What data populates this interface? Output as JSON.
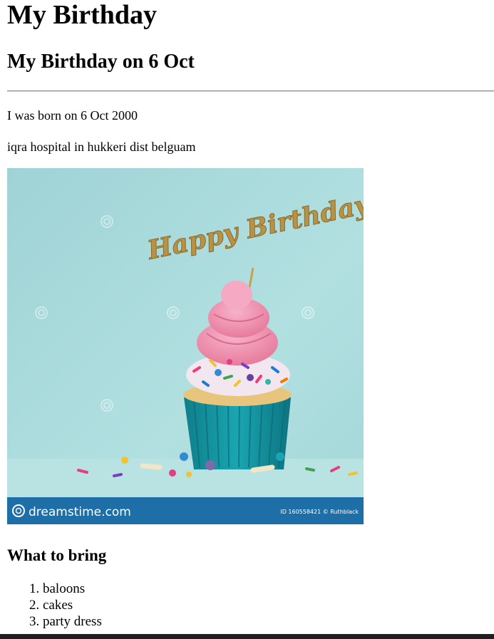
{
  "heading": "My Birthday",
  "subheading": "My Birthday on 6 Oct",
  "paragraphs": {
    "born": "I was born on 6 Oct 2000",
    "place": "iqra hospital in hukkeri dist belguam"
  },
  "image": {
    "topper_text": "Happy Birthday",
    "watermark_brand": "dreamstime.com",
    "watermark_id": "ID 160558421 © Ruthblack",
    "colors": {
      "background": "#a9dbdc",
      "frosting": "#f08fb0",
      "cup": "#169aa6",
      "banner": "#1e6fa7"
    }
  },
  "bring": {
    "title": "What to bring",
    "items": [
      "baloons",
      "cakes",
      "party dress"
    ]
  }
}
